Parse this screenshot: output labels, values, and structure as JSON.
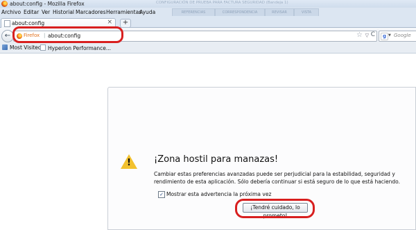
{
  "window": {
    "title": "about:config - Mozilla Firefox",
    "ghost_texts": [
      "CONFIGURACIÓN DE PRUEBA PARA FACTURA SEGURIDAD (Bandeja 1)",
      "REFERENCIAS",
      "CORRESPONDENCIA",
      "REVISAR",
      "VISTA"
    ]
  },
  "menu": {
    "items": [
      "Archivo",
      "Editar",
      "Ver",
      "Historial",
      "Marcadores",
      "Herramientas",
      "Ayuda"
    ]
  },
  "tabs": {
    "active_label": "about:config",
    "close_glyph": "×",
    "new_tab_glyph": "+"
  },
  "navbar": {
    "back_glyph": "←",
    "identity_label": "Firefox",
    "separator": "|",
    "url": "about:config",
    "star_glyph": "☆",
    "dropdown_glyph": "▽",
    "reload_glyph": "C",
    "search_engine_letter": "g",
    "search_placeholder": "Google",
    "search_caret": "▼"
  },
  "bookmarks": {
    "items": [
      "Most Visited",
      "Hyperion Performance..."
    ]
  },
  "warning": {
    "title": "¡Zona hostil para manazas!",
    "text": "Cambiar estas preferencias avanzadas puede ser perjudicial para la estabilidad, seguridad y rendimiento de esta aplicación. Sólo debería continuar si está seguro de lo que está haciendo.",
    "exclamation": "!",
    "checkbox_label": "Mostrar esta advertencia la próxima vez",
    "checkbox_checked": true,
    "check_glyph": "✓",
    "button_label": "¡Tendré cuidado, lo prometo!"
  },
  "colors": {
    "annotation_red": "#d81f1f",
    "warning_yellow": "#f2c12e",
    "firefox_orange": "#e0701c"
  }
}
